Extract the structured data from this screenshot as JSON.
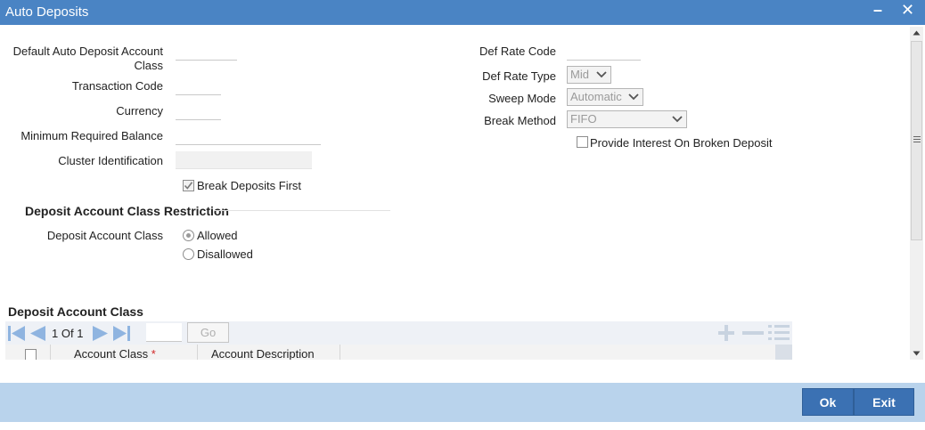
{
  "window": {
    "title": "Auto Deposits",
    "minimize_glyph": "–",
    "close_glyph": "✕"
  },
  "form_left": {
    "default_class_label_line1": "Default Auto Deposit Account",
    "default_class_label_line2": "Class",
    "default_class_value": "",
    "transaction_code_label": "Transaction Code",
    "transaction_code_value": "",
    "currency_label": "Currency",
    "currency_value": "",
    "min_balance_label": "Minimum Required Balance",
    "min_balance_value": "",
    "cluster_label": "Cluster Identification",
    "cluster_value": "",
    "break_first_label": "Break Deposits First",
    "break_first_checked": true
  },
  "form_right": {
    "def_rate_code_label": "Def Rate Code",
    "def_rate_code_value": "",
    "def_rate_type_label": "Def Rate Type",
    "def_rate_type_value": "Mid",
    "sweep_mode_label": "Sweep Mode",
    "sweep_mode_value": "Automatic",
    "break_method_label": "Break Method",
    "break_method_value": "FIFO",
    "provide_interest_label": "Provide Interest On Broken Deposit",
    "provide_interest_checked": false
  },
  "restriction": {
    "section_title": "Deposit Account Class Restriction",
    "field_label": "Deposit Account Class",
    "allowed_label": "Allowed",
    "disallowed_label": "Disallowed",
    "selected": "Allowed"
  },
  "grid": {
    "section_title": "Deposit Account Class",
    "page_current": "1",
    "page_of": "Of",
    "page_total": "1",
    "go_label": "Go",
    "columns": [
      {
        "label": "Account Class",
        "required_mark": "*"
      },
      {
        "label": "Account Description"
      }
    ],
    "icons": [
      "first-page-icon",
      "prev-page-icon",
      "next-page-icon",
      "last-page-icon",
      "add-row-icon",
      "delete-row-icon",
      "single-view-icon"
    ]
  },
  "footer": {
    "ok_label": "Ok",
    "exit_label": "Exit"
  },
  "colors": {
    "titlebar": "#4a84c4",
    "footer": "#b9d3ec",
    "button": "#3b71b3",
    "nav_icon": "#8fb4e0",
    "required": "#d12727"
  }
}
